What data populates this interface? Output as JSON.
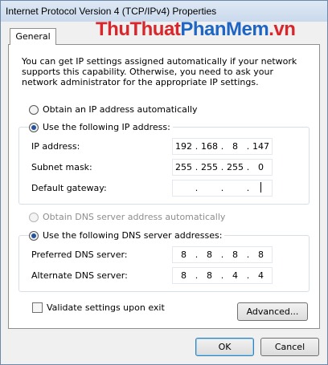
{
  "window": {
    "title": "Internet Protocol Version 4 (TCP/IPv4) Properties"
  },
  "watermark": {
    "part1": "Thu",
    "part2": "Thuat",
    "part3": "Phan",
    "part4": "Mem",
    "part5": ".vn"
  },
  "tabs": [
    {
      "label": "General",
      "active": true
    }
  ],
  "intro_text": "You can get IP settings assigned automatically if your network supports this capability. Otherwise, you need to ask your network administrator for the appropriate IP settings.",
  "ip_section": {
    "auto_label": "Obtain an IP address automatically",
    "auto_selected": false,
    "manual_label": "Use the following IP address:",
    "manual_selected": true,
    "fields": [
      {
        "label": "IP address:",
        "octets": [
          "192",
          "168",
          "8",
          "147"
        ]
      },
      {
        "label": "Subnet mask:",
        "octets": [
          "255",
          "255",
          "255",
          "0"
        ]
      },
      {
        "label": "Default gateway:",
        "octets": [
          "",
          "",
          "",
          ""
        ]
      }
    ]
  },
  "dns_section": {
    "auto_label": "Obtain DNS server address automatically",
    "auto_selected": false,
    "auto_enabled": false,
    "manual_label": "Use the following DNS server addresses:",
    "manual_selected": true,
    "fields": [
      {
        "label": "Preferred DNS server:",
        "octets": [
          "8",
          "8",
          "8",
          "8"
        ]
      },
      {
        "label": "Alternate DNS server:",
        "octets": [
          "8",
          "8",
          "4",
          "4"
        ]
      }
    ]
  },
  "validate": {
    "label": "Validate settings upon exit",
    "checked": false
  },
  "buttons": {
    "advanced": "Advanced...",
    "ok": "OK",
    "cancel": "Cancel"
  }
}
